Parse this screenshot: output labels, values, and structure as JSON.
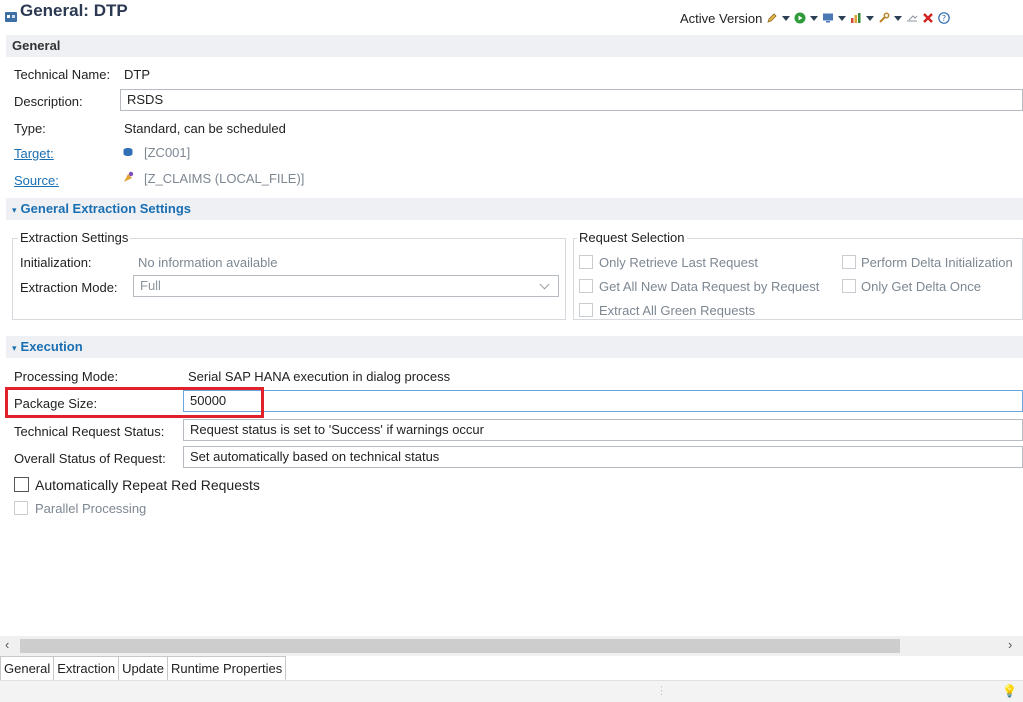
{
  "header": {
    "title": "General: DTP",
    "version_label": "Active Version",
    "toolbar_icons": [
      "edit-icon",
      "run-icon",
      "monitor-icon",
      "chart-icon",
      "wrench-icon",
      "flag-icon",
      "close-icon",
      "help-icon"
    ]
  },
  "general": {
    "section_title": "General",
    "technical_name_label": "Technical Name:",
    "technical_name_value": "DTP",
    "description_label": "Description:",
    "description_value": "RSDS",
    "type_label": "Type:",
    "type_value": "Standard, can be scheduled",
    "target_label": "Target:",
    "target_value": "[ZC001]",
    "source_label": "Source:",
    "source_value": "[Z_CLAIMS (LOCAL_FILE)]"
  },
  "extraction_settings_section": {
    "section_title": "General Extraction Settings",
    "extraction_group": {
      "title": "Extraction Settings",
      "initialization_label": "Initialization:",
      "initialization_value": "No information available",
      "mode_label": "Extraction Mode:",
      "mode_value": "Full"
    },
    "request_group": {
      "title": "Request Selection",
      "options": [
        "Only Retrieve Last Request",
        "Get All New Data Request by Request",
        "Extract All Green Requests",
        "Perform Delta Initialization",
        "Only Get Delta Once"
      ]
    }
  },
  "execution": {
    "section_title": "Execution",
    "processing_mode_label": "Processing Mode:",
    "processing_mode_value": "Serial SAP HANA execution in dialog process",
    "package_size_label": "Package Size:",
    "package_size_value": "50000",
    "tech_status_label": "Technical Request Status:",
    "tech_status_value": "Request status is set to 'Success' if warnings occur",
    "overall_status_label": "Overall Status of Request:",
    "overall_status_value": "Set automatically based on technical status",
    "auto_repeat_label": "Automatically Repeat Red Requests",
    "parallel_label": "Parallel Processing"
  },
  "tabs": [
    "General",
    "Extraction",
    "Update",
    "Runtime Properties"
  ],
  "colors": {
    "accent": "#1a6fb3",
    "highlight": "#e0202a",
    "section_bg": "#eef0f3"
  }
}
